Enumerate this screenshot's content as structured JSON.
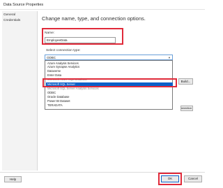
{
  "window": {
    "title": "Data Source Properties"
  },
  "sidebar": {
    "items": [
      {
        "label": "General"
      },
      {
        "label": "Credentials"
      }
    ]
  },
  "main": {
    "heading": "Change name, type, and connection options.",
    "name_label": "Name:",
    "name_value": "EmployeeData",
    "connection_type_label": "Select connection type:",
    "connection_type_selected": "ODBC",
    "dropdown_items": [
      {
        "label": "Azure Analysis Services"
      },
      {
        "label": "Azure Synapse Analytics"
      },
      {
        "label": "Dataverse"
      },
      {
        "label": "Enter Data"
      },
      {
        "label": "Microsoft Azure SQL Database"
      },
      {
        "label": "Microsoft SQL Server"
      },
      {
        "label": "Microsoft SQL Server Analysis Services"
      },
      {
        "label": "ODBC"
      },
      {
        "label": "Oracle Database"
      },
      {
        "label": "Power BI Dataset"
      },
      {
        "label": "TERADATA"
      }
    ],
    "build_button": "Build...",
    "test_connection_button": "Test Connection"
  },
  "footer": {
    "help_button": "Help",
    "ok_button": "OK",
    "cancel_button": "Cancel"
  },
  "highlight_color": "#e02a3a",
  "selection_color": "#0a5fc9"
}
